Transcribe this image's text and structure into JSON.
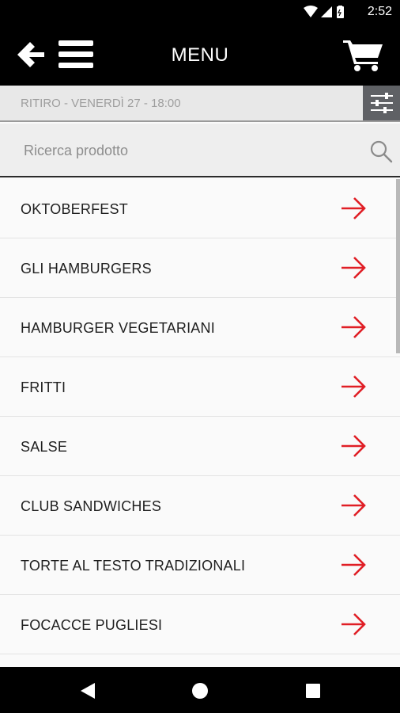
{
  "status_bar": {
    "time": "2:52"
  },
  "header": {
    "title": "MENU"
  },
  "pickup": {
    "text": "RITIRO - VENERDÌ 27 - 18:00"
  },
  "search": {
    "placeholder": "Ricerca prodotto"
  },
  "categories": [
    {
      "label": "OKTOBERFEST"
    },
    {
      "label": "GLI HAMBURGERS"
    },
    {
      "label": "HAMBURGER VEGETARIANI"
    },
    {
      "label": "FRITTI"
    },
    {
      "label": "SALSE"
    },
    {
      "label": "CLUB SANDWICHES"
    },
    {
      "label": "TORTE AL TESTO TRADIZIONALI"
    },
    {
      "label": "FOCACCE PUGLIESI"
    }
  ],
  "colors": {
    "accent": "#e01e25",
    "bar": "#000000",
    "filter": "#5f6165"
  },
  "icons": {
    "back": "arrow-left-icon",
    "menu": "hamburger-icon",
    "cart": "cart-icon",
    "filter": "sliders-icon",
    "search": "search-icon",
    "item": "arrow-right-icon",
    "nav_back": "triangle-back-icon",
    "nav_home": "circle-home-icon",
    "nav_recent": "square-recent-icon"
  }
}
